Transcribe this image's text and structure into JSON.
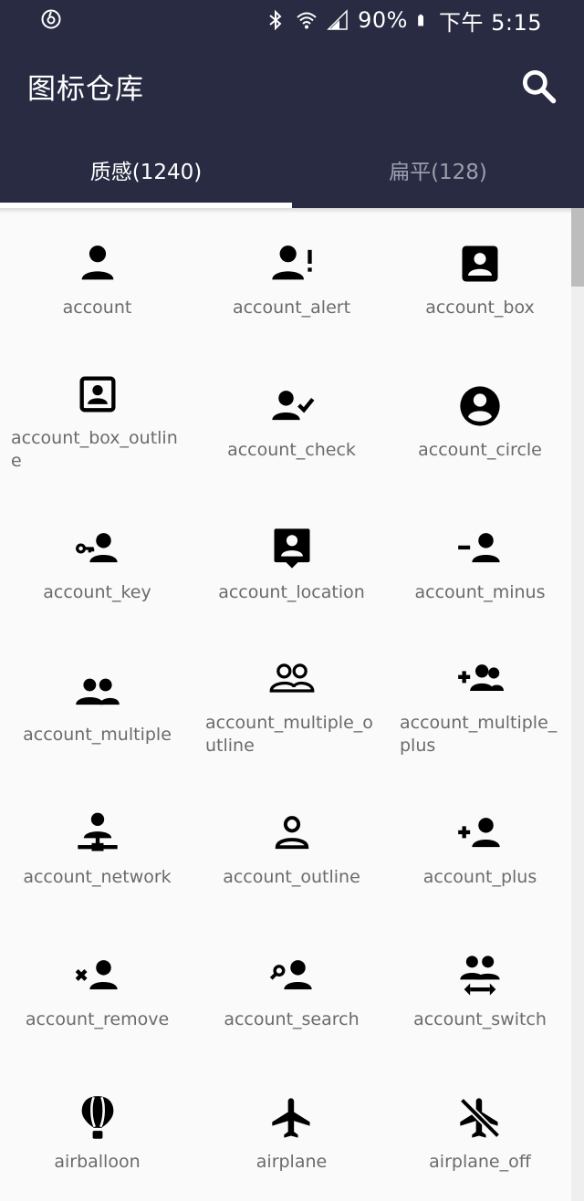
{
  "status_bar": {
    "battery_percent": "90%",
    "time": "下午 5:15",
    "icons": [
      "netease-music-icon",
      "bluetooth-icon",
      "wifi-icon",
      "signal-icon",
      "battery-icon"
    ]
  },
  "app": {
    "title": "图标仓库",
    "search_icon": "search-icon"
  },
  "tabs": [
    {
      "label": "质感(1240)",
      "active": true
    },
    {
      "label": "扁平(128)",
      "active": false
    }
  ],
  "colors": {
    "header": "#282b42",
    "tab_active": "#ffffff",
    "tab_inactive": "#9c9eac",
    "label": "#6b6b6b",
    "background": "#fafafa"
  },
  "icons": [
    {
      "label": "account"
    },
    {
      "label": "account_alert"
    },
    {
      "label": "account_box"
    },
    {
      "label": "account_box_outline"
    },
    {
      "label": "account_check"
    },
    {
      "label": "account_circle"
    },
    {
      "label": "account_key"
    },
    {
      "label": "account_location"
    },
    {
      "label": "account_minus"
    },
    {
      "label": "account_multiple"
    },
    {
      "label": "account_multiple_outline"
    },
    {
      "label": "account_multiple_plus"
    },
    {
      "label": "account_network"
    },
    {
      "label": "account_outline"
    },
    {
      "label": "account_plus"
    },
    {
      "label": "account_remove"
    },
    {
      "label": "account_search"
    },
    {
      "label": "account_switch"
    },
    {
      "label": "airballoon"
    },
    {
      "label": "airplane"
    },
    {
      "label": "airplane_off"
    }
  ]
}
